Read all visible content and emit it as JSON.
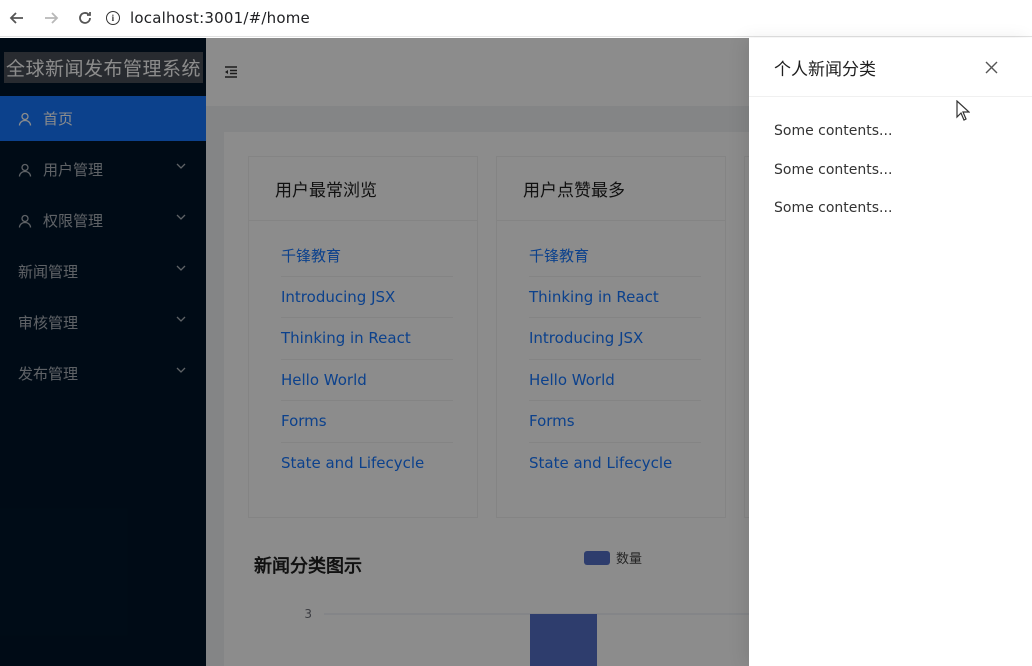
{
  "browser": {
    "url": "localhost:3001/#/home"
  },
  "sider": {
    "logo_text": "全球新闻发布管理系统",
    "items": [
      {
        "label": "首页",
        "icon": "user-icon",
        "selected": true
      },
      {
        "label": "用户管理",
        "icon": "user-icon",
        "expandable": true
      },
      {
        "label": "权限管理",
        "icon": "user-icon",
        "expandable": true
      },
      {
        "label": "新闻管理",
        "expandable": true
      },
      {
        "label": "审核管理",
        "expandable": true
      },
      {
        "label": "发布管理",
        "expandable": true
      }
    ]
  },
  "cards": [
    {
      "title": "用户最常浏览",
      "items": [
        "千锋教育",
        "Introducing JSX",
        "Thinking in React",
        "Hello World",
        "Forms",
        "State and Lifecycle"
      ]
    },
    {
      "title": "用户点赞最多",
      "items": [
        "千锋教育",
        "Thinking in React",
        "Introducing JSX",
        "Hello World",
        "Forms",
        "State and Lifecycle"
      ]
    }
  ],
  "chart": {
    "title": "新闻分类图示"
  },
  "chart_data": {
    "type": "bar",
    "legend": [
      "数量"
    ],
    "legend_position": "top",
    "ytick_visible": [
      "3"
    ],
    "series": [
      {
        "name": "数量",
        "values": [
          3
        ]
      }
    ],
    "color": "#5470c6"
  },
  "drawer": {
    "title": "个人新闻分类",
    "contents": [
      "Some contents...",
      "Some contents...",
      "Some contents..."
    ]
  },
  "colors": {
    "sider_bg": "#001529",
    "primary": "#1677ff",
    "mask": "rgba(0,0,0,0.45)"
  }
}
